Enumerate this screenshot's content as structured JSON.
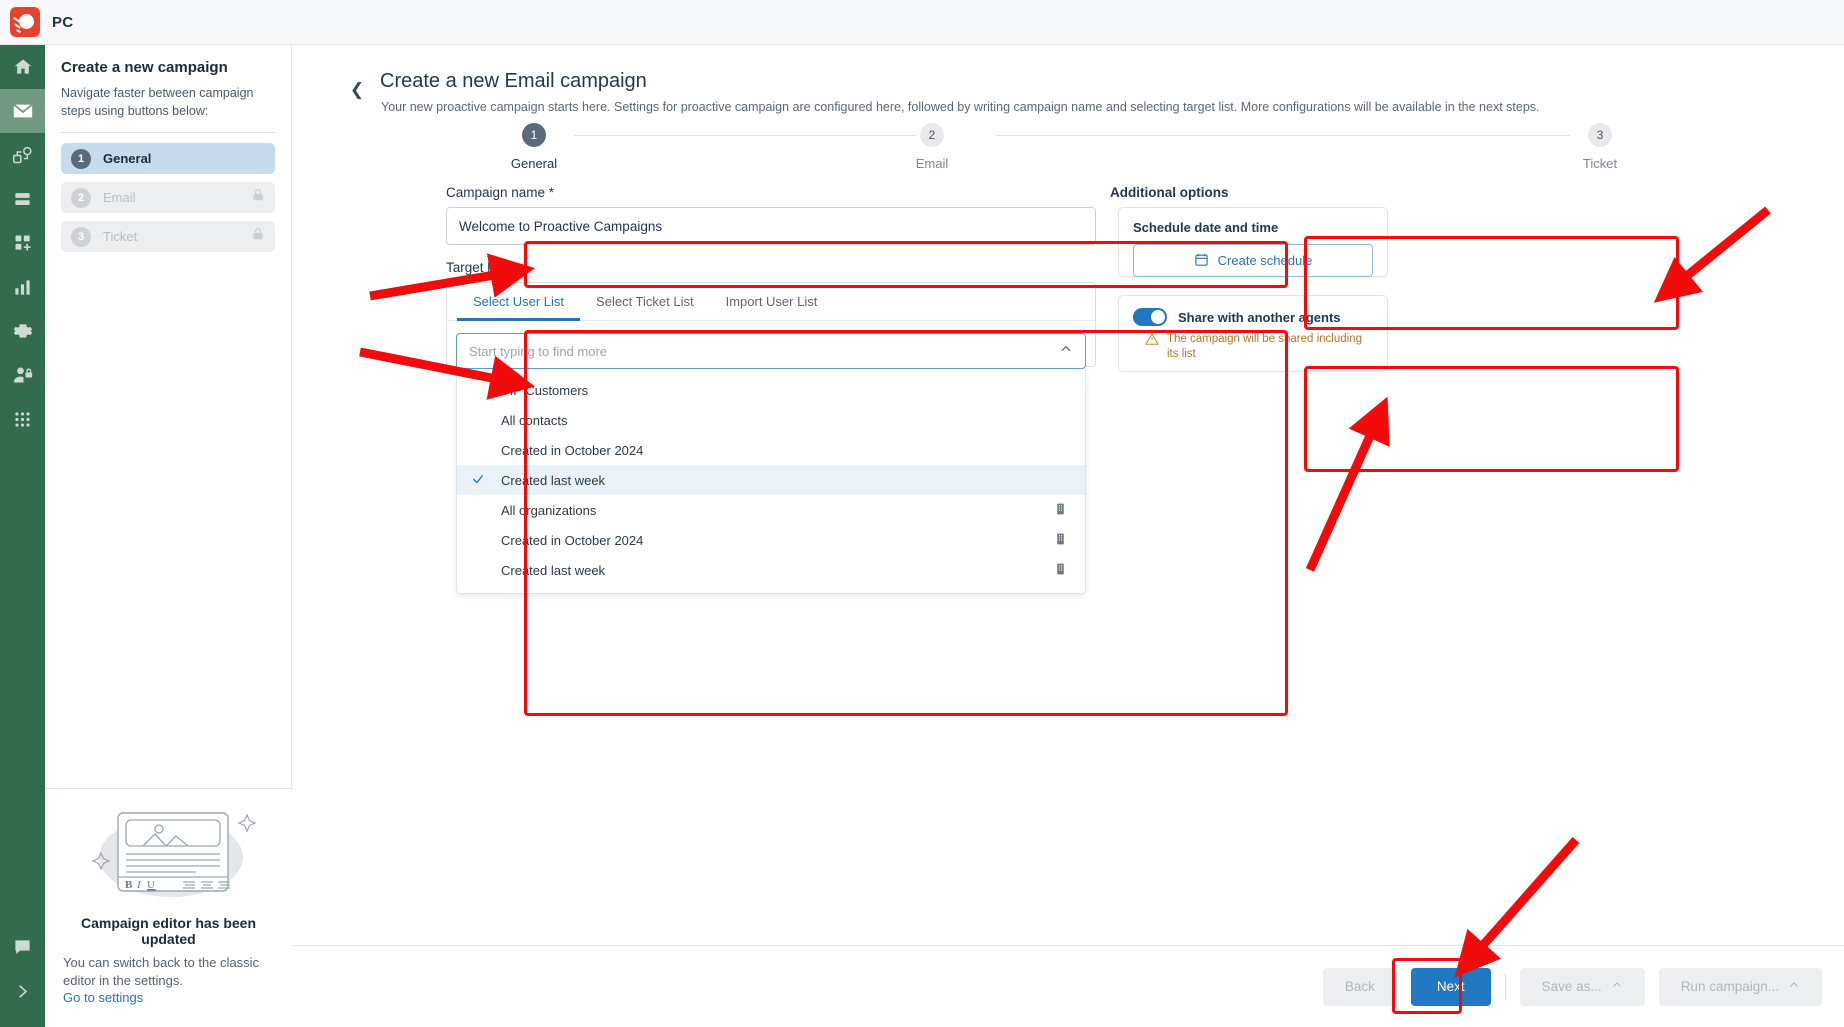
{
  "topbar": {
    "product_code": "PC",
    "logo_icon": "sun-logo-icon"
  },
  "rail": {
    "items": [
      {
        "icon": "home-icon",
        "name": "home"
      },
      {
        "icon": "envelope-icon",
        "name": "campaigns",
        "active": true
      },
      {
        "icon": "automation-flow-icon",
        "name": "automation"
      },
      {
        "icon": "database-icon",
        "name": "data"
      },
      {
        "icon": "add-widget-icon",
        "name": "apps-add"
      },
      {
        "icon": "bar-chart-icon",
        "name": "reports"
      },
      {
        "icon": "gear-icon",
        "name": "settings"
      },
      {
        "icon": "user-lock-icon",
        "name": "permissions"
      },
      {
        "icon": "grid-dots-icon",
        "name": "all-apps"
      }
    ],
    "bottom": [
      {
        "icon": "chat-bubble-icon",
        "name": "chat"
      },
      {
        "icon": "chevron-right-icon",
        "name": "expand-rail"
      }
    ]
  },
  "left_panel": {
    "title": "Create a new campaign",
    "subtitle": "Navigate faster between campaign steps using buttons below:",
    "steps": [
      {
        "number": "1",
        "label": "General",
        "locked": false,
        "selected": true
      },
      {
        "number": "2",
        "label": "Email",
        "locked": true,
        "selected": false
      },
      {
        "number": "3",
        "label": "Ticket",
        "locked": true,
        "selected": false
      }
    ],
    "promo": {
      "heading": "Campaign editor has been updated",
      "body": "You can switch back to the classic editor in the settings.",
      "link": "Go to settings",
      "art_tools": [
        "B",
        "I",
        "U"
      ]
    }
  },
  "main": {
    "back_icon": "chevron-left-icon",
    "title": "Create a new Email campaign",
    "subtitle": "Your new proactive campaign starts here. Settings for proactive campaign are configured here, followed by writing campaign name and selecting target list. More configurations will be available in the next steps.",
    "stepper": [
      {
        "number": "1",
        "label": "General",
        "current": true
      },
      {
        "number": "2",
        "label": "Email",
        "current": false
      },
      {
        "number": "3",
        "label": "Ticket",
        "current": false
      }
    ],
    "campaign_name": {
      "label": "Campaign name *",
      "value": "Welcome to Proactive Campaigns"
    },
    "target_list": {
      "label": "Target list *",
      "tabs": [
        {
          "label": "Select User List",
          "active": true
        },
        {
          "label": "Select Ticket List",
          "active": false
        },
        {
          "label": "Import User List",
          "active": false
        }
      ],
      "search_placeholder": "Start typing to find more",
      "collapse_icon": "chevron-up-icon",
      "options": [
        {
          "label": "VIP Customers",
          "checked": false,
          "icon": ""
        },
        {
          "label": "All contacts",
          "checked": false,
          "icon": ""
        },
        {
          "label": "Created in October 2024",
          "checked": false,
          "icon": ""
        },
        {
          "label": "Created last week",
          "checked": true,
          "icon": ""
        },
        {
          "label": "All organizations",
          "checked": false,
          "icon": "building-icon"
        },
        {
          "label": "Created in October 2024",
          "checked": false,
          "icon": "building-icon"
        },
        {
          "label": "Created last week",
          "checked": false,
          "icon": "building-icon"
        }
      ]
    },
    "additional_options": {
      "label": "Additional options",
      "schedule": {
        "title": "Schedule date and time",
        "button_label": "Create schedule",
        "button_icon": "calendar-icon"
      },
      "share": {
        "toggle_label": "Share with another agents",
        "toggle_on": true,
        "warning_icon": "warning-triangle-icon",
        "warning_text": "The campaign will be shared including its list"
      }
    }
  },
  "footer": {
    "back_label": "Back",
    "next_label": "Next",
    "save_as_label": "Save as...",
    "run_campaign_label": "Run campaign...",
    "caret_icon": "chevron-up-icon"
  },
  "colors": {
    "rail_green": "#336b4f",
    "rail_active": "#6f9a81",
    "primary_blue": "#1f78c1",
    "link_blue": "#2b72b5",
    "annotation_red": "#f10b0b",
    "warning_amber": "#b5762a",
    "selected_step": "#c6dced"
  }
}
